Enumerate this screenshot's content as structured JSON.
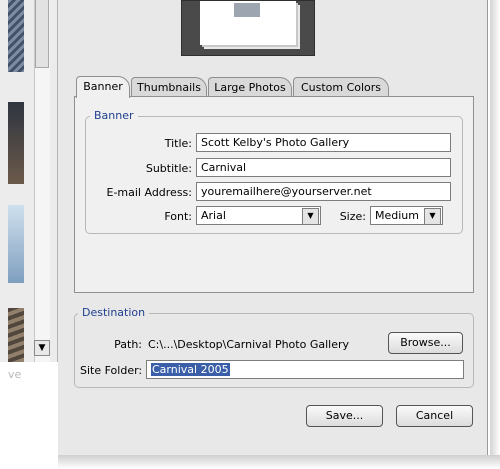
{
  "left_strip": {
    "partial_label": "ve",
    "scroll_down_icon": "chevron-down-icon"
  },
  "tabs": [
    {
      "label": "Banner",
      "active": true
    },
    {
      "label": "Thumbnails",
      "active": false
    },
    {
      "label": "Large Photos",
      "active": false
    },
    {
      "label": "Custom Colors",
      "active": false
    }
  ],
  "banner": {
    "legend": "Banner",
    "title_label": "Title:",
    "title_value": "Scott Kelby's Photo Gallery",
    "subtitle_label": "Subtitle:",
    "subtitle_value": "Carnival",
    "email_label": "E-mail Address:",
    "email_value": "youremailhere@yourserver.net",
    "font_label": "Font:",
    "font_value": "Arial",
    "size_label": "Size:",
    "size_value": "Medium"
  },
  "destination": {
    "legend": "Destination",
    "path_label": "Path:",
    "path_value": "C:\\...\\Desktop\\Carnival Photo Gallery",
    "browse_label": "Browse...",
    "site_folder_label": "Site Folder:",
    "site_folder_value": "Carnival 2005"
  },
  "footer": {
    "save_label": "Save...",
    "cancel_label": "Cancel"
  },
  "colors": {
    "legend": "#1f3f8f",
    "selection": "#3a5fa8",
    "dialog_bg": "#e8e8e8"
  }
}
